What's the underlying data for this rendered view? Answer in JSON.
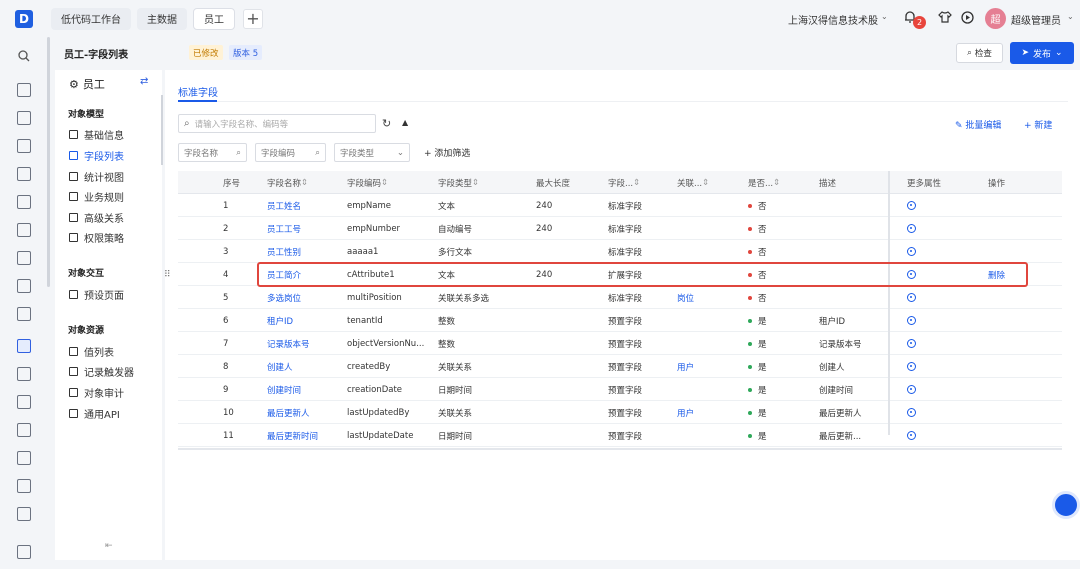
{
  "topbar": {
    "logo": "D",
    "tabs": [
      "低代码工作台",
      "主数据",
      "员工"
    ],
    "add": "+",
    "company": "上海汉得信息技术股",
    "notification_count": "2",
    "avatar_text": "超",
    "user": "超级管理员"
  },
  "header": {
    "title": "员工-字段列表",
    "modified": "已修改",
    "version": "版本 5",
    "check": "检查",
    "publish": "发布"
  },
  "objnav": {
    "object": "员工",
    "groups": [
      {
        "title": "对象模型",
        "items": [
          "基础信息",
          "字段列表",
          "统计视图",
          "业务规则",
          "高级关系",
          "权限策略"
        ]
      },
      {
        "title": "对象交互",
        "items": [
          "预设页面"
        ]
      },
      {
        "title": "对象资源",
        "items": [
          "值列表",
          "记录触发器",
          "对象审计",
          "通用API"
        ]
      }
    ],
    "active": "字段列表"
  },
  "main": {
    "subtab": "标准字段",
    "search_placeholder": "请输入字段名称、编码等",
    "batch_edit": "批量编辑",
    "new": "新建",
    "filters": [
      "字段名称",
      "字段编码",
      "字段类型"
    ],
    "add_filter": "添加筛选"
  },
  "table": {
    "headers": [
      "序号",
      "字段名称",
      "字段编码",
      "字段类型",
      "最大长度",
      "字段...",
      "关联...",
      "是否...",
      "描述",
      "更多属性",
      "操作"
    ],
    "rows": [
      {
        "no": "1",
        "name": "员工姓名",
        "code": "empName",
        "type": "文本",
        "maxlen": "240",
        "cat": "标准字段",
        "rel": "",
        "flag": "否",
        "desc": "",
        "op": ""
      },
      {
        "no": "2",
        "name": "员工工号",
        "code": "empNumber",
        "type": "自动编号",
        "maxlen": "240",
        "cat": "标准字段",
        "rel": "",
        "flag": "否",
        "desc": "",
        "op": ""
      },
      {
        "no": "3",
        "name": "员工性别",
        "code": "aaaaa1",
        "type": "多行文本",
        "maxlen": "",
        "cat": "标准字段",
        "rel": "",
        "flag": "否",
        "desc": "",
        "op": ""
      },
      {
        "no": "4",
        "name": "员工简介",
        "code": "cAttribute1",
        "type": "文本",
        "maxlen": "240",
        "cat": "扩展字段",
        "rel": "",
        "flag": "否",
        "desc": "",
        "op": "删除"
      },
      {
        "no": "5",
        "name": "多选岗位",
        "code": "multiPosition",
        "type": "关联关系多选",
        "maxlen": "",
        "cat": "标准字段",
        "rel": "岗位",
        "flag": "否",
        "desc": "",
        "op": ""
      },
      {
        "no": "6",
        "name": "租户ID",
        "code": "tenantId",
        "type": "整数",
        "maxlen": "",
        "cat": "预置字段",
        "rel": "",
        "flag": "是",
        "desc": "租户ID",
        "op": ""
      },
      {
        "no": "7",
        "name": "记录版本号",
        "code": "objectVersionNu...",
        "type": "整数",
        "maxlen": "",
        "cat": "预置字段",
        "rel": "",
        "flag": "是",
        "desc": "记录版本号",
        "op": ""
      },
      {
        "no": "8",
        "name": "创建人",
        "code": "createdBy",
        "type": "关联关系",
        "maxlen": "",
        "cat": "预置字段",
        "rel": "用户",
        "flag": "是",
        "desc": "创建人",
        "op": ""
      },
      {
        "no": "9",
        "name": "创建时间",
        "code": "creationDate",
        "type": "日期时间",
        "maxlen": "",
        "cat": "预置字段",
        "rel": "",
        "flag": "是",
        "desc": "创建时间",
        "op": ""
      },
      {
        "no": "10",
        "name": "最后更新人",
        "code": "lastUpdatedBy",
        "type": "关联关系",
        "maxlen": "",
        "cat": "预置字段",
        "rel": "用户",
        "flag": "是",
        "desc": "最后更新人",
        "op": ""
      },
      {
        "no": "11",
        "name": "最后更新时间",
        "code": "lastUpdateDate",
        "type": "日期时间",
        "maxlen": "",
        "cat": "预置字段",
        "rel": "",
        "flag": "是",
        "desc": "最后更新...",
        "op": ""
      }
    ]
  },
  "colors": {
    "accent": "#1a5ae8",
    "no": "#e0463d",
    "yes": "#2fa85a",
    "highlight": "#e0463d"
  }
}
